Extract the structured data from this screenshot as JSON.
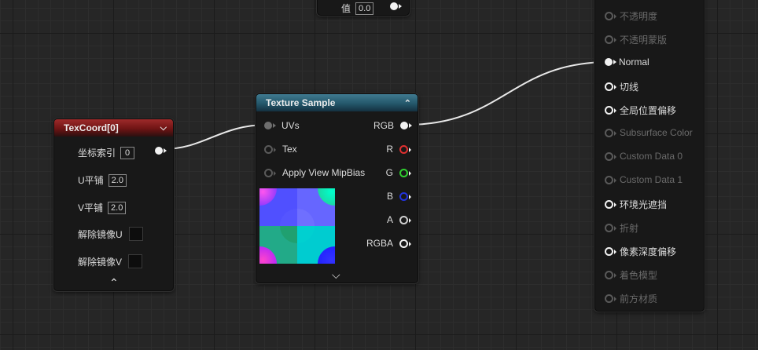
{
  "top_node": {
    "label": "值",
    "value": "0.0"
  },
  "texcoord": {
    "title": "TexCoord[0]",
    "rows": [
      {
        "label": "坐标索引",
        "value": "0"
      },
      {
        "label": "U平铺",
        "value": "2.0"
      },
      {
        "label": "V平铺",
        "value": "2.0"
      },
      {
        "label": "解除镜像U"
      },
      {
        "label": "解除镜像V"
      }
    ]
  },
  "texture_sample": {
    "title": "Texture Sample",
    "inputs": [
      "UVs",
      "Tex",
      "Apply View MipBias"
    ],
    "outputs": [
      {
        "label": "RGB",
        "color": "#f2f2f2"
      },
      {
        "label": "R",
        "color": "#e03030"
      },
      {
        "label": "G",
        "color": "#30d030"
      },
      {
        "label": "B",
        "color": "#2233dd"
      },
      {
        "label": "A",
        "color": "#cfcfcf"
      },
      {
        "label": "RGBA",
        "color": "#f2f2f2"
      }
    ]
  },
  "material_result": {
    "pins": [
      {
        "label": "不透明度",
        "active": false
      },
      {
        "label": "不透明蒙版",
        "active": false
      },
      {
        "label": "Normal",
        "active": true,
        "connected": true
      },
      {
        "label": "切线",
        "active": true
      },
      {
        "label": "全局位置偏移",
        "active": true
      },
      {
        "label": "Subsurface Color",
        "active": false
      },
      {
        "label": "Custom Data 0",
        "active": false
      },
      {
        "label": "Custom Data 1",
        "active": false
      },
      {
        "label": "环境光遮挡",
        "active": true
      },
      {
        "label": "折射",
        "active": false
      },
      {
        "label": "像素深度偏移",
        "active": true
      },
      {
        "label": "着色模型",
        "active": false
      },
      {
        "label": "前方材质",
        "active": false
      }
    ]
  }
}
